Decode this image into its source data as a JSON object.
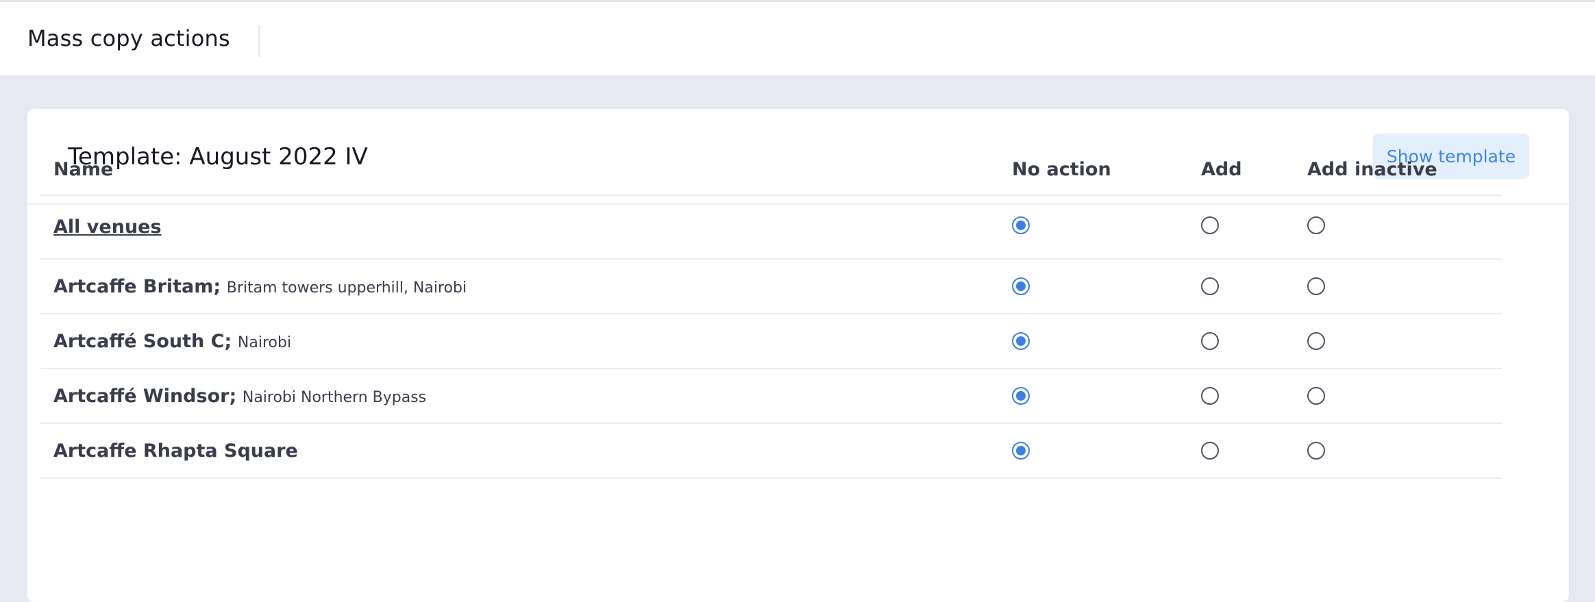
{
  "header": {
    "title": "Mass copy actions"
  },
  "card": {
    "title": "Template: August 2022 IV",
    "show_template_label": "Show template"
  },
  "table": {
    "columns": {
      "name": "Name",
      "no_action": "No action",
      "add": "Add",
      "add_inactive": "Add inactive"
    },
    "all_row": {
      "label": "All venues",
      "selected": "no_action"
    },
    "rows": [
      {
        "name": "Artcaffe Britam",
        "separator": ";",
        "location": "Britam towers upperhill, Nairobi",
        "selected": "no_action"
      },
      {
        "name": "Artcaffé South C",
        "separator": ";",
        "location": "Nairobi",
        "selected": "no_action"
      },
      {
        "name": "Artcaffé Windsor",
        "separator": ";",
        "location": "Nairobi Northern Bypass",
        "selected": "no_action"
      },
      {
        "name": "Artcaffe Rhapta Square",
        "separator": "",
        "location": "",
        "selected": "no_action"
      }
    ]
  },
  "colors": {
    "accent": "#3d7fe0",
    "button_bg": "#e4effc",
    "page_bg": "#e6e8f2"
  }
}
